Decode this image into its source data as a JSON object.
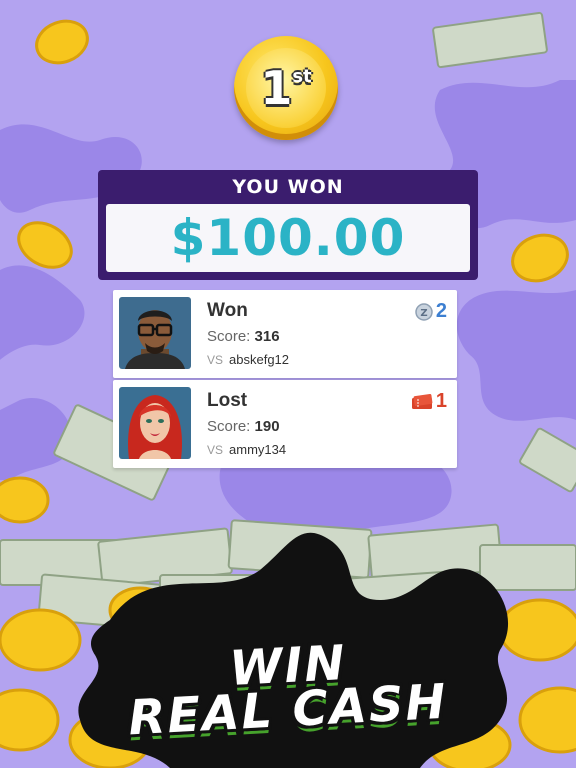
{
  "colors": {
    "background": "#b3a3f0",
    "splat": "#9b87e8",
    "panel": "#3b1d6e",
    "amount": "#2bb3c6",
    "coin": "#f7c61d",
    "cash": "#cfd9c8"
  },
  "medal": {
    "number": "1",
    "suffix": "st",
    "icon": "first-place-medal-icon"
  },
  "prize_panel": {
    "title": "YOU WON",
    "amount": "$100.00"
  },
  "results": [
    {
      "outcome": "Won",
      "score_label": "Score:",
      "score": "316",
      "vs_label": "VS",
      "opponent": "abskefg12",
      "prize_count": "2",
      "prize_icon": "z-token-icon"
    },
    {
      "outcome": "Lost",
      "score_label": "Score:",
      "score": "190",
      "vs_label": "VS",
      "opponent": "ammy134",
      "prize_count": "1",
      "prize_icon": "ticket-icon"
    }
  ],
  "promo": {
    "line1": "WIN",
    "line2": "REAL CASH"
  }
}
